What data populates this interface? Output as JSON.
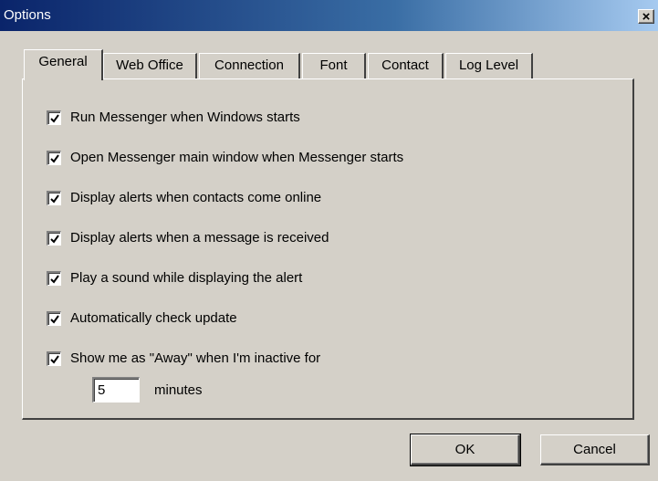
{
  "window": {
    "title": "Options",
    "close_glyph": "×"
  },
  "tabs": [
    {
      "label": "General",
      "active": true
    },
    {
      "label": "Web Office",
      "active": false
    },
    {
      "label": "Connection",
      "active": false
    },
    {
      "label": "Font",
      "active": false
    },
    {
      "label": "Contact",
      "active": false
    },
    {
      "label": "Log Level",
      "active": false
    }
  ],
  "options": [
    {
      "label": "Run Messenger when Windows starts",
      "checked": true
    },
    {
      "label": "Open Messenger main window when Messenger starts",
      "checked": true
    },
    {
      "label": "Display alerts when contacts come online",
      "checked": true
    },
    {
      "label": "Display alerts when a message is received",
      "checked": true
    },
    {
      "label": "Play a sound while displaying the alert",
      "checked": true
    },
    {
      "label": "Automatically check update",
      "checked": true
    },
    {
      "label": "Show me as \"Away\" when I'm inactive for",
      "checked": true
    }
  ],
  "inactive": {
    "value": "5",
    "unit_label": "minutes"
  },
  "buttons": {
    "ok_label": "OK",
    "cancel_label": "Cancel"
  },
  "icons": {
    "checkmark": "check-icon",
    "close": "close-icon"
  }
}
